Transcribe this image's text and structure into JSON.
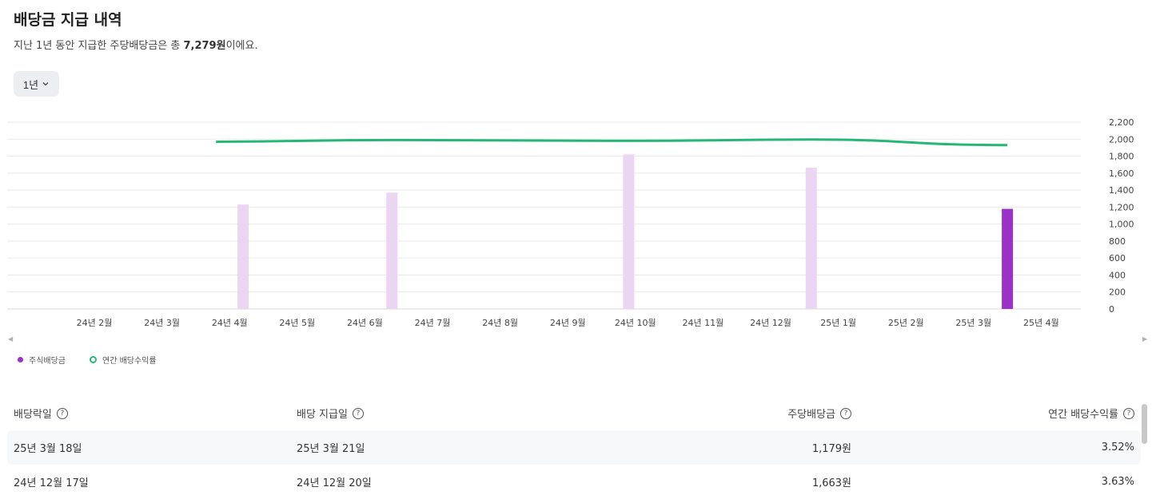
{
  "page": {
    "title": "배당금 지급 내역",
    "subtitle_prefix": "지난 1년 동안 지급한 주당배당금은 총 ",
    "subtitle_total": "7,279원",
    "subtitle_suffix": "이에요."
  },
  "filter": {
    "period_label": "1년"
  },
  "legend": {
    "dividend_label": "주식배당금",
    "yield_label": "연간 배당수익률"
  },
  "colors": {
    "bar_active": "#9a32c7",
    "bar_inactive": "#ead5f3",
    "yield_line": "#26b777",
    "grid": "#e9e9e9"
  },
  "chart_data": {
    "type": "bar",
    "categories": [
      "24년 2월",
      "24년 3월",
      "24년 4월",
      "24년 5월",
      "24년 6월",
      "24년 7월",
      "24년 8월",
      "24년 9월",
      "24년 10월",
      "24년 11월",
      "24년 12월",
      "25년 1월",
      "25년 2월",
      "25년 3월",
      "25년 4월"
    ],
    "y_ticks": [
      "2,200",
      "2,000",
      "1,800",
      "1,600",
      "1,400",
      "1,200",
      "1,000",
      "800",
      "600",
      "400",
      "200",
      "0"
    ],
    "ylim": [
      0,
      2200
    ],
    "bars": [
      {
        "value": 1230,
        "pos": 2.2,
        "highlight": false
      },
      {
        "value": 1370,
        "pos": 4.4,
        "highlight": false
      },
      {
        "value": 1820,
        "pos": 7.9,
        "highlight": false
      },
      {
        "value": 1663,
        "pos": 10.6,
        "highlight": false
      },
      {
        "value": 1179,
        "pos": 13.5,
        "highlight": true
      }
    ],
    "yield_line": [
      {
        "pos": 1.8,
        "value": 1970
      },
      {
        "pos": 4.4,
        "value": 1990
      },
      {
        "pos": 7.9,
        "value": 1980
      },
      {
        "pos": 10.6,
        "value": 1995
      },
      {
        "pos": 13.5,
        "value": 1930
      }
    ]
  },
  "table": {
    "headers": {
      "ex_date": "배당락일",
      "pay_date": "배당 지급일",
      "dps": "주당배당금",
      "yield": "연간 배당수익률"
    },
    "rows": [
      {
        "ex_date": "25년 3월 18일",
        "pay_date": "25년 3월 21일",
        "dps": "1,179원",
        "yield": "3.52%"
      },
      {
        "ex_date": "24년 12월 17일",
        "pay_date": "24년 12월 20일",
        "dps": "1,663원",
        "yield": "3.63%"
      }
    ]
  }
}
